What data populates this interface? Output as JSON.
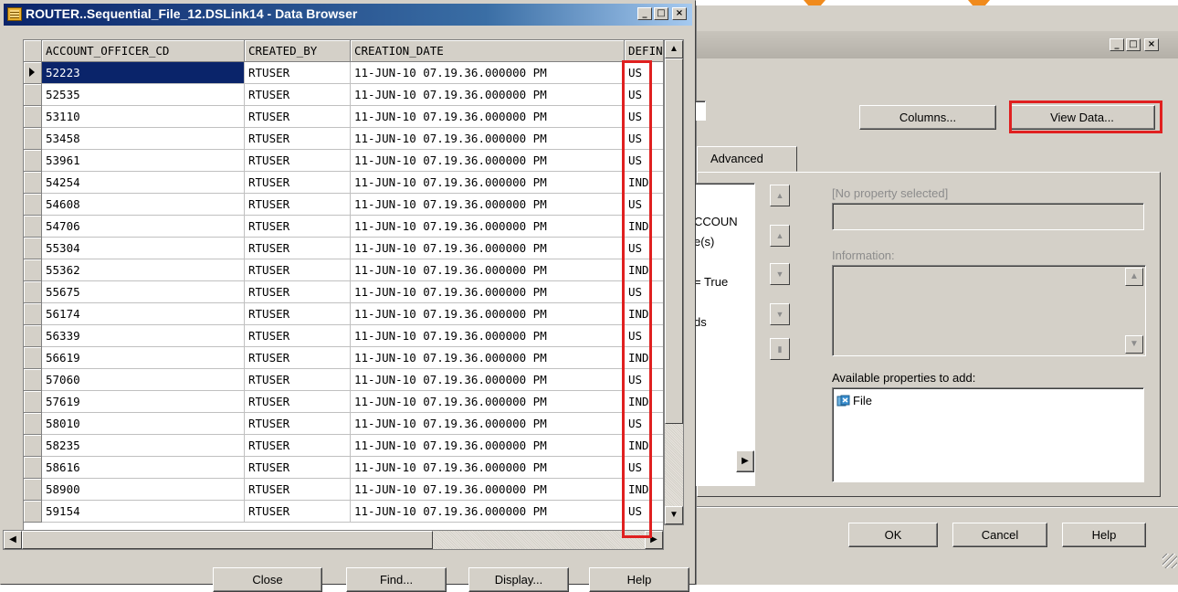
{
  "browser": {
    "title": "ROUTER..Sequential_File_12.DSLink14 - Data Browser",
    "window_controls": [
      "_",
      "□",
      "×"
    ],
    "columns": [
      "ACCOUNT_OFFICER_CD",
      "CREATED_BY",
      "CREATION_DATE",
      "DEFINI"
    ],
    "rows": [
      [
        "52223",
        "RTUSER",
        "11-JUN-10 07.19.36.000000 PM",
        "US"
      ],
      [
        "52535",
        "RTUSER",
        "11-JUN-10 07.19.36.000000 PM",
        "US"
      ],
      [
        "53110",
        "RTUSER",
        "11-JUN-10 07.19.36.000000 PM",
        "US"
      ],
      [
        "53458",
        "RTUSER",
        "11-JUN-10 07.19.36.000000 PM",
        "US"
      ],
      [
        "53961",
        "RTUSER",
        "11-JUN-10 07.19.36.000000 PM",
        "US"
      ],
      [
        "54254",
        "RTUSER",
        "11-JUN-10 07.19.36.000000 PM",
        "IND"
      ],
      [
        "54608",
        "RTUSER",
        "11-JUN-10 07.19.36.000000 PM",
        "US"
      ],
      [
        "54706",
        "RTUSER",
        "11-JUN-10 07.19.36.000000 PM",
        "IND"
      ],
      [
        "55304",
        "RTUSER",
        "11-JUN-10 07.19.36.000000 PM",
        "US"
      ],
      [
        "55362",
        "RTUSER",
        "11-JUN-10 07.19.36.000000 PM",
        "IND"
      ],
      [
        "55675",
        "RTUSER",
        "11-JUN-10 07.19.36.000000 PM",
        "US"
      ],
      [
        "56174",
        "RTUSER",
        "11-JUN-10 07.19.36.000000 PM",
        "IND"
      ],
      [
        "56339",
        "RTUSER",
        "11-JUN-10 07.19.36.000000 PM",
        "US"
      ],
      [
        "56619",
        "RTUSER",
        "11-JUN-10 07.19.36.000000 PM",
        "IND"
      ],
      [
        "57060",
        "RTUSER",
        "11-JUN-10 07.19.36.000000 PM",
        "US"
      ],
      [
        "57619",
        "RTUSER",
        "11-JUN-10 07.19.36.000000 PM",
        "IND"
      ],
      [
        "58010",
        "RTUSER",
        "11-JUN-10 07.19.36.000000 PM",
        "US"
      ],
      [
        "58235",
        "RTUSER",
        "11-JUN-10 07.19.36.000000 PM",
        "IND"
      ],
      [
        "58616",
        "RTUSER",
        "11-JUN-10 07.19.36.000000 PM",
        "US"
      ],
      [
        "58900",
        "RTUSER",
        "11-JUN-10 07.19.36.000000 PM",
        "IND"
      ],
      [
        "59154",
        "RTUSER",
        "11-JUN-10 07.19.36.000000 PM",
        "US"
      ]
    ],
    "selected_row": 0,
    "buttons": {
      "close": "Close",
      "find": "Find...",
      "display": "Display...",
      "help": "Help"
    }
  },
  "properties": {
    "columns_button": "Columns...",
    "view_data_button": "View Data...",
    "advanced_tab": "Advanced",
    "tree_fragments": [
      "CCOUN",
      "e(s)",
      "= True",
      "ds"
    ],
    "no_property_selected": "[No property selected]",
    "information_label": "Information:",
    "available_properties_label": "Available properties to add:",
    "available_properties": [
      "File"
    ],
    "ok_button": "OK",
    "cancel_button": "Cancel",
    "help_button": "Help"
  },
  "colors": {
    "highlight_box": "#e02020",
    "selection": "#0a246a",
    "title_gradient_start": "#0a246a",
    "decor_accent": "#f08a1c"
  }
}
